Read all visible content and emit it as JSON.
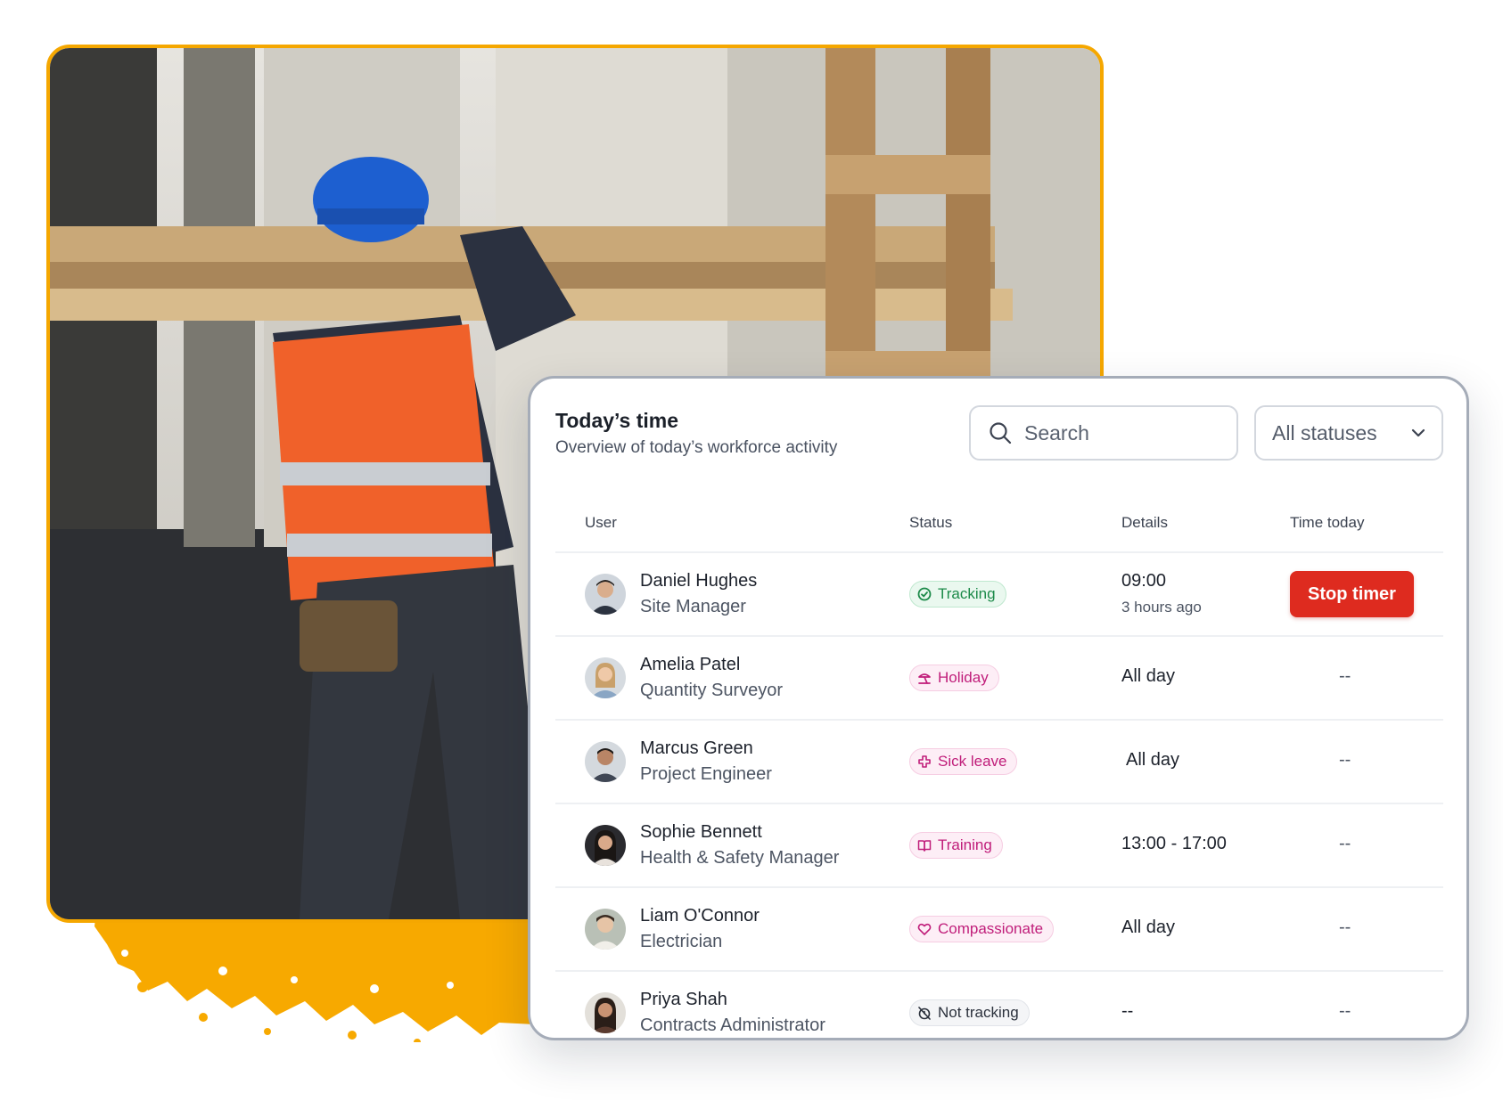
{
  "card": {
    "title": "Today’s time",
    "subtitle": "Overview of today’s workforce activity",
    "search": {
      "placeholder": "Search",
      "icon": "search-icon"
    },
    "status_filter": {
      "selected": "All statuses",
      "icon": "chevron-down-icon"
    }
  },
  "table": {
    "columns": {
      "user": "User",
      "status": "Status",
      "details": "Details",
      "time_today": "Time today"
    },
    "rows": [
      {
        "name": "Daniel Hughes",
        "role": "Site Manager",
        "status": "Tracking",
        "status_icon": "tracking-icon",
        "details": "09:00",
        "details_sub": "3 hours ago",
        "time_today": "Stop timer"
      },
      {
        "name": "Amelia Patel",
        "role": "Quantity Surveyor",
        "status": "Holiday",
        "status_icon": "holiday-icon",
        "details": "All day",
        "time_today": "--"
      },
      {
        "name": "Marcus Green",
        "role": "Project Engineer",
        "status": "Sick leave",
        "status_icon": "sick-leave-icon",
        "details": "All day",
        "time_today": "--"
      },
      {
        "name": "Sophie Bennett",
        "role": "Health & Safety Manager",
        "status": "Training",
        "status_icon": "training-icon",
        "details": "13:00 - 17:00",
        "time_today": "--"
      },
      {
        "name": "Liam O'Connor",
        "role": "Electrician",
        "status": "Compassionate",
        "status_icon": "heart-icon",
        "details": "All day",
        "time_today": "--"
      },
      {
        "name": "Priya Shah",
        "role": "Contracts Administrator",
        "status": "Not tracking",
        "status_icon": "not-tracking-icon",
        "details": "--",
        "time_today": "--"
      }
    ]
  },
  "colors": {
    "accent_orange": "#f5a700",
    "stop_red": "#de2b1f",
    "tracking_green": "#1c8a49",
    "leave_pink": "#c01d7a",
    "card_border": "#a5acb8"
  }
}
